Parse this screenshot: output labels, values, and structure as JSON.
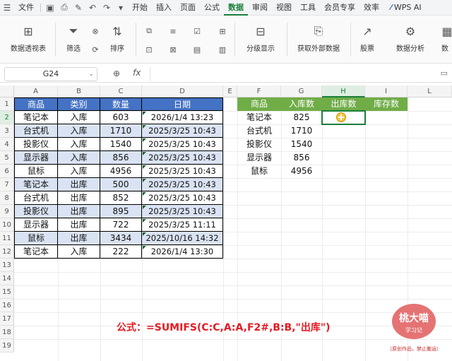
{
  "menu": {
    "file": "文件",
    "tabs": [
      "开始",
      "插入",
      "页面",
      "公式",
      "数据",
      "审阅",
      "视图",
      "工具",
      "会员专享",
      "效率"
    ],
    "active_tab": "数据",
    "wps_ai": "WPS AI"
  },
  "ribbon": {
    "pivot": "数据透视表",
    "filter": "筛选",
    "sort": "排序",
    "group": "分级显示",
    "external": "获取外部数据",
    "stocks": "股票",
    "analysis": "数据分析",
    "more": "数"
  },
  "formula_bar": {
    "name_box": "G24",
    "fx": "fx",
    "value": ""
  },
  "sheet": {
    "columns": [
      "A",
      "B",
      "C",
      "D",
      "E",
      "F",
      "G",
      "H",
      "I",
      "L"
    ],
    "rows": [
      "1",
      "2",
      "3",
      "4",
      "5",
      "6",
      "7",
      "8",
      "9",
      "10",
      "11",
      "12",
      "13",
      "14",
      "15",
      "16",
      "17",
      "18",
      "19"
    ],
    "selected_column": "H",
    "selected_row": "2"
  },
  "table1": {
    "headers": [
      "商品",
      "类别",
      "数量",
      "日期"
    ],
    "rows": [
      [
        "笔记本",
        "入库",
        "603",
        "2026/1/4 13:23"
      ],
      [
        "台式机",
        "入库",
        "1710",
        "2025/3/25 10:43"
      ],
      [
        "投影仪",
        "入库",
        "1540",
        "2025/3/25 10:43"
      ],
      [
        "显示器",
        "入库",
        "856",
        "2025/3/25 10:43"
      ],
      [
        "鼠标",
        "入库",
        "4956",
        "2025/3/25 10:43"
      ],
      [
        "笔记本",
        "出库",
        "500",
        "2025/3/25 10:43"
      ],
      [
        "台式机",
        "出库",
        "852",
        "2025/3/25 10:43"
      ],
      [
        "投影仪",
        "出库",
        "895",
        "2025/3/25 10:43"
      ],
      [
        "显示器",
        "出库",
        "722",
        "2025/3/25 11:11"
      ],
      [
        "鼠标",
        "出库",
        "3434",
        "2025/10/16 14:32"
      ],
      [
        "笔记本",
        "入库",
        "222",
        "2026/1/4 13:30"
      ]
    ]
  },
  "table2": {
    "headers": [
      "商品",
      "入库数",
      "出库数",
      "库存数"
    ],
    "rows": [
      [
        "笔记本",
        "825"
      ],
      [
        "台式机",
        "1710"
      ],
      [
        "投影仪",
        "1540"
      ],
      [
        "显示器",
        "856"
      ],
      [
        "鼠标",
        "4956"
      ]
    ]
  },
  "annotation": {
    "formula": "公式：=SUMIFS(C:C,A:A,F2#,B:B,\"出库\")"
  },
  "watermark": {
    "name": "桃大喵",
    "sub": "学习记",
    "note": "（原创作品，禁止搬运）"
  },
  "colors": {
    "header_blue": "#4472c4",
    "row_shade": "#dae3f3",
    "header_green": "#70ad47",
    "accent": "#1a7f3a",
    "formula_red": "#e51c23"
  }
}
